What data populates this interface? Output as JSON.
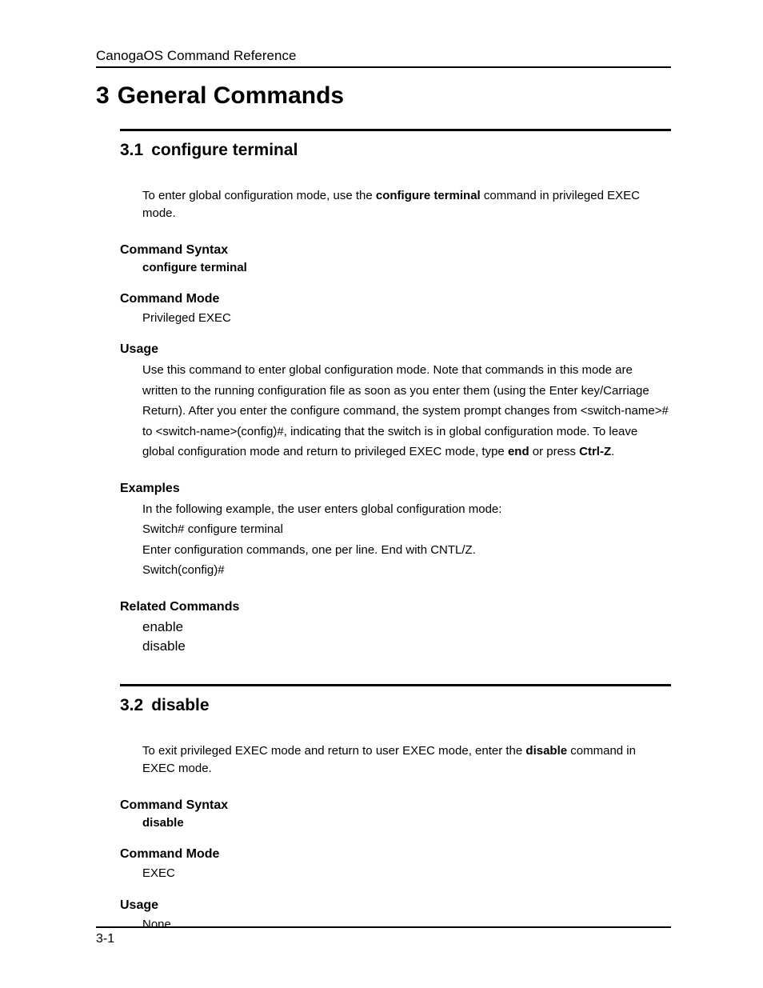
{
  "header": {
    "running": "CanogaOS  Command  Reference"
  },
  "chapter": {
    "number": "3",
    "title": "General Commands"
  },
  "section1": {
    "number": "3.1",
    "title": "configure terminal",
    "intro_pre": "To enter global configuration mode, use the ",
    "intro_bold": "configure terminal",
    "intro_post": " command in privileged EXEC mode.",
    "syntax_head": "Command Syntax",
    "syntax_value": "configure terminal",
    "mode_head": "Command Mode",
    "mode_value": "Privileged EXEC",
    "usage_head": "Usage",
    "usage_p1": "Use this command to enter global configuration mode. Note that commands in this mode are written to the running configuration file as soon as you enter them (using the Enter key/Carriage Return). After you enter the configure command, the system prompt changes from <switch-name># to <switch-name>(config)#, indicating that the switch is in global configuration mode. To leave global configuration mode and return to privileged EXEC mode, type ",
    "usage_bold1": "end",
    "usage_mid": " or press ",
    "usage_bold2": "Ctrl-Z",
    "usage_end": ".",
    "examples_head": "Examples",
    "ex_l1": "In the following example, the user enters global configuration mode:",
    "ex_l2_pre": "Switch# ",
    "ex_l2_bold": "configure terminal",
    "ex_l3": "Enter configuration commands, one per line. End with CNTL/Z.",
    "ex_l4": "Switch(config)#",
    "related_head": "Related Commands",
    "related1": "enable",
    "related2": "disable"
  },
  "section2": {
    "number": "3.2",
    "title": "disable",
    "intro_pre": "To exit privileged EXEC mode and return to user EXEC mode, enter the ",
    "intro_bold": "disable",
    "intro_post": " command in EXEC mode.",
    "syntax_head": "Command Syntax",
    "syntax_value": "disable",
    "mode_head": "Command Mode",
    "mode_value": "EXEC",
    "usage_head": "Usage",
    "usage_value": "None."
  },
  "footer": {
    "page": "3-1"
  }
}
